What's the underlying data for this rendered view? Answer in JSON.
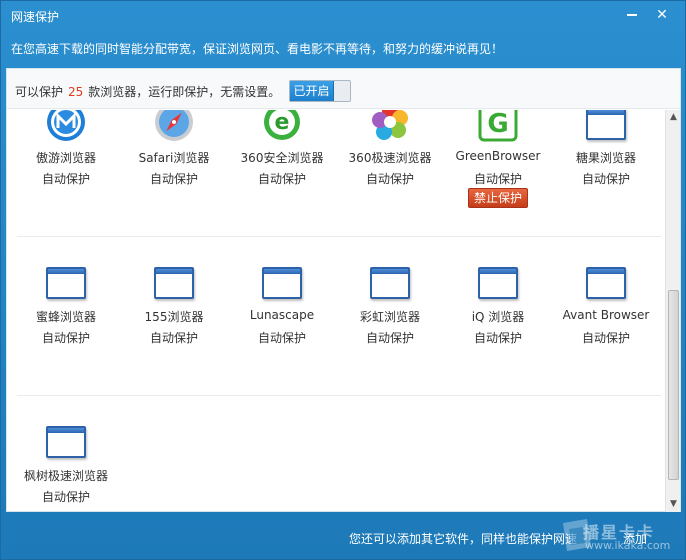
{
  "window": {
    "title": "网速保护"
  },
  "banner": {
    "text": "在您高速下载的同时智能分配带宽，保证浏览网页、看电影不再等待，和努力的缓冲说再见！"
  },
  "infobar": {
    "prefix": "可以保护",
    "count": "25",
    "suffix": "款浏览器，运行即保护，无需设置。",
    "toggle_label": "已开启"
  },
  "browsers": [
    {
      "name": "傲游浏览器",
      "status": "自动保护",
      "icon": "maxthon-icon"
    },
    {
      "name": "Safari浏览器",
      "status": "自动保护",
      "icon": "safari-icon"
    },
    {
      "name": "360安全浏览器",
      "status": "自动保护",
      "icon": "360-secure-icon"
    },
    {
      "name": "360极速浏览器",
      "status": "自动保护",
      "icon": "360-speed-icon"
    },
    {
      "name": "GreenBrowser",
      "status": "自动保护",
      "icon": "greenbrowser-icon",
      "button": "禁止保护"
    },
    {
      "name": "糖果浏览器",
      "status": "自动保护",
      "icon": "window-icon"
    },
    {
      "name": "蜜蜂浏览器",
      "status": "自动保护",
      "icon": "window-icon"
    },
    {
      "name": "155浏览器",
      "status": "自动保护",
      "icon": "window-icon"
    },
    {
      "name": "Lunascape",
      "status": "自动保护",
      "icon": "window-icon"
    },
    {
      "name": "彩虹浏览器",
      "status": "自动保护",
      "icon": "window-icon"
    },
    {
      "name": "iQ 浏览器",
      "status": "自动保护",
      "icon": "window-icon"
    },
    {
      "name": "Avant Browser",
      "status": "自动保护",
      "icon": "window-icon"
    },
    {
      "name": "枫树极速浏览器",
      "status": "自动保护",
      "icon": "window-icon"
    }
  ],
  "footer": {
    "text": "您还可以添加其它软件，同样也能保护网速",
    "add_label": "添加"
  },
  "watermark": {
    "cn": "播星卡卡",
    "url": "www.ikaka.com"
  },
  "colors": {
    "accent": "#2b8fd0",
    "count": "#e23b1b",
    "stop_button": "#c43d18"
  }
}
